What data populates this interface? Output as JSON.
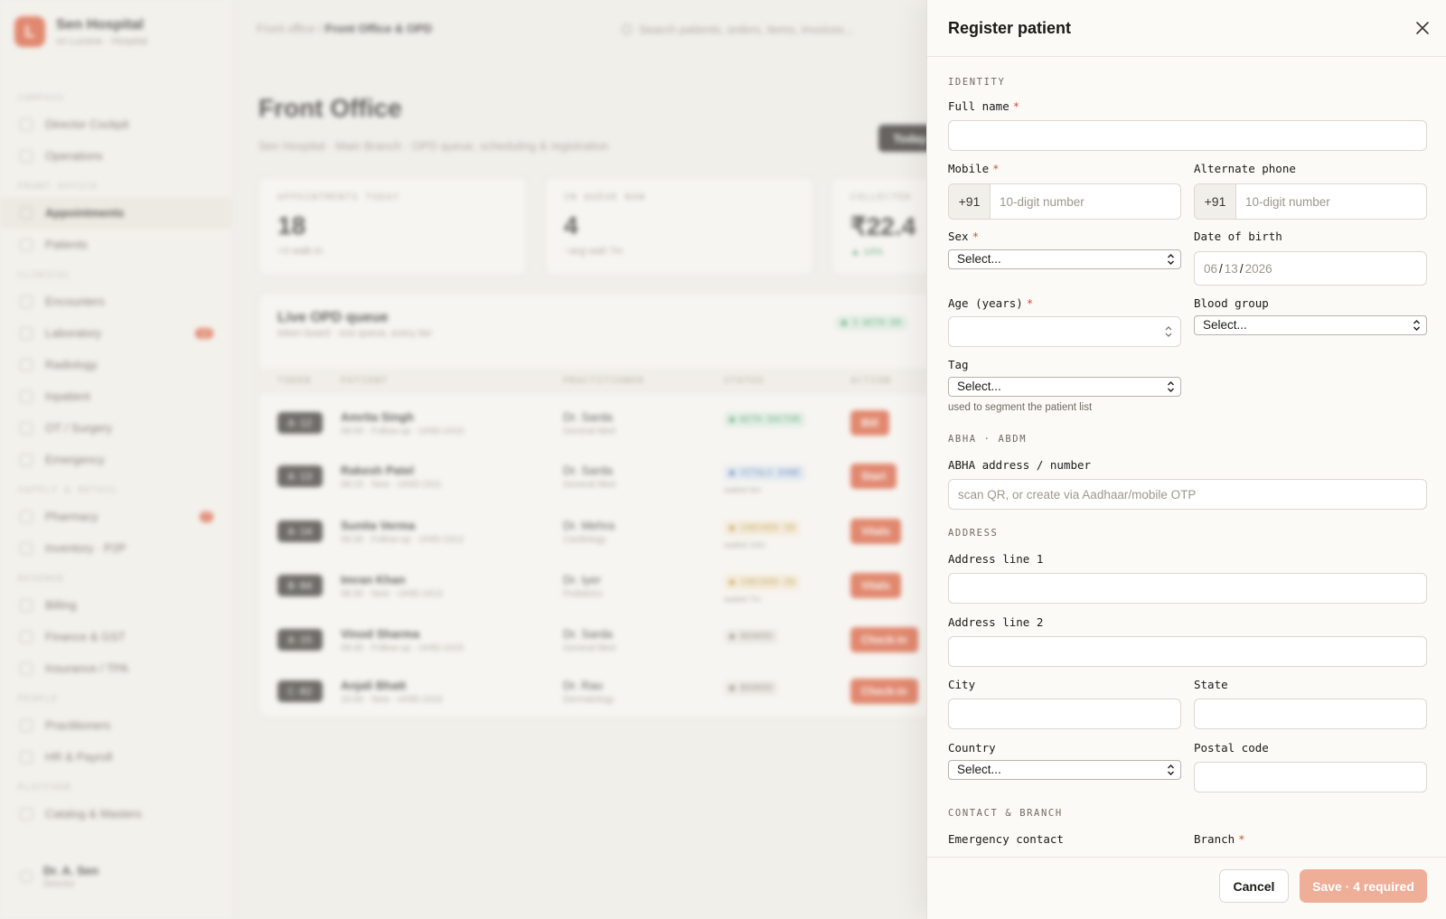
{
  "app": {
    "brand_logo": "L",
    "brand_name": "Sen Hospital",
    "brand_sub": "on Lucene · Hospital",
    "breadcrumb_parent": "Front office /",
    "breadcrumb_current": "Front Office & OPD",
    "search_placeholder": "Search patients, orders, items, invoices..."
  },
  "sidebar": {
    "sections": [
      {
        "label": "COMPASS",
        "items": [
          {
            "label": "Director Cockpit"
          },
          {
            "label": "Operations"
          }
        ]
      },
      {
        "label": "FRONT OFFICE",
        "items": [
          {
            "label": "Appointments",
            "active": true
          },
          {
            "label": "Patients"
          }
        ]
      },
      {
        "label": "CLINICAL",
        "items": [
          {
            "label": "Encounters"
          },
          {
            "label": "Laboratory",
            "badge": "12"
          },
          {
            "label": "Radiology"
          },
          {
            "label": "Inpatient"
          },
          {
            "label": "OT / Surgery"
          },
          {
            "label": "Emergency"
          }
        ]
      },
      {
        "label": "SUPPLY & RETAIL",
        "items": [
          {
            "label": "Pharmacy",
            "badge": "7"
          },
          {
            "label": "Inventory · P2P"
          }
        ]
      },
      {
        "label": "REVENUE",
        "items": [
          {
            "label": "Billing"
          },
          {
            "label": "Finance & GST"
          },
          {
            "label": "Insurance / TPA"
          }
        ]
      },
      {
        "label": "PEOPLE",
        "items": [
          {
            "label": "Practitioners"
          },
          {
            "label": "HR & Payroll"
          }
        ]
      },
      {
        "label": "PLATFORM",
        "items": [
          {
            "label": "Catalog & Masters"
          }
        ]
      }
    ],
    "user_name": "Dr. A. Sen",
    "user_role": "Director"
  },
  "main": {
    "title": "Front Office",
    "subtitle": "Sen Hospital · Main Branch · OPD queue, scheduling & registration",
    "today_button": "Today",
    "stats": [
      {
        "label": "APPOINTMENTS TODAY",
        "value": "18",
        "note": "+3 walk-in",
        "tone": "muted"
      },
      {
        "label": "IN QUEUE NOW",
        "value": "4",
        "note": "~avg wait 7m",
        "tone": "muted"
      },
      {
        "label": "COLLECTED",
        "value": "₹22.4",
        "note": "▲ 14%",
        "tone": "up"
      }
    ],
    "queue": {
      "title": "Live OPD queue",
      "subtitle": "token board · one queue, every tier",
      "pill": "● 3 WITH DR",
      "headers": {
        "token": "TOKEN",
        "patient": "PATIENT",
        "practitioner": "PRACTITIONER",
        "status": "STATUS",
        "action": "ACTION"
      },
      "rows": [
        {
          "token": "A-12",
          "patient": "Amrita Singh",
          "meta": "09:00 · Follow-up · UHID-2410",
          "doctor": "Dr. Sarda",
          "dept": "General Med",
          "status": "● WITH DOCTOR",
          "status_sub": "",
          "status_color": "#2f8f55",
          "status_bg": "#dcefe3",
          "action": "Bill"
        },
        {
          "token": "A-13",
          "patient": "Rakesh Patel",
          "meta": "09:15 · New · UHID-2411",
          "doctor": "Dr. Sarda",
          "dept": "General Med",
          "status": "● VITALS DONE",
          "status_sub": "waited 6m",
          "status_color": "#3b6fb0",
          "status_bg": "#dde7f4",
          "action": "Start"
        },
        {
          "token": "A-14",
          "patient": "Sunita Verma",
          "meta": "09:30 · Follow-up · UHID-2412",
          "doctor": "Dr. Mehra",
          "dept": "Cardiology",
          "status": "● CHECKED-IN",
          "status_sub": "waited 14m",
          "status_color": "#b7862a",
          "status_bg": "#f6ecd6",
          "action": "Vitals"
        },
        {
          "token": "B-04",
          "patient": "Imran Khan",
          "meta": "09:30 · New · UHID-2413",
          "doctor": "Dr. Iyer",
          "dept": "Pediatrics",
          "status": "● CHECKED-IN",
          "status_sub": "waited 7m",
          "status_color": "#b7862a",
          "status_bg": "#f6ecd6",
          "action": "Vitals"
        },
        {
          "token": "A-15",
          "patient": "Vinod Sharma",
          "meta": "09:45 · Follow-up · UHID-2415",
          "doctor": "Dr. Sarda",
          "dept": "General Med",
          "status": "● BOOKED",
          "status_sub": "",
          "status_color": "#6f6a61",
          "status_bg": "#eceae5",
          "action": "Check-in"
        },
        {
          "token": "C-02",
          "patient": "Anjali Bhatt",
          "meta": "10:00 · New · UHID-2416",
          "doctor": "Dr. Rao",
          "dept": "Dermatology",
          "status": "● BOOKED",
          "status_sub": "",
          "status_color": "#6f6a61",
          "status_bg": "#eceae5",
          "action": "Check-in"
        }
      ]
    }
  },
  "drawer": {
    "title": "Register patient",
    "close_icon": "close-icon",
    "accent": "#d9522f",
    "sections": {
      "identity": "IDENTITY",
      "abha": "ABHA · ABDM",
      "address": "ADDRESS",
      "contact": "CONTACT & BRANCH"
    },
    "fields": {
      "full_name": {
        "label": "Full name",
        "required": "*",
        "value": ""
      },
      "mobile": {
        "label": "Mobile",
        "required": "*",
        "prefix": "+91",
        "placeholder": "10-digit number"
      },
      "alt_phone": {
        "label": "Alternate phone",
        "prefix": "+91",
        "placeholder": "10-digit number"
      },
      "sex": {
        "label": "Sex",
        "required": "*",
        "selected": "Select..."
      },
      "dob": {
        "label": "Date of birth",
        "month": "06",
        "day": "13",
        "year": "2026"
      },
      "age": {
        "label": "Age (years)",
        "required": "*",
        "value": ""
      },
      "blood_group": {
        "label": "Blood group",
        "selected": "Select..."
      },
      "tag": {
        "label": "Tag",
        "selected": "Select...",
        "hint": "used to segment the patient list"
      },
      "abha": {
        "label": "ABHA address / number",
        "placeholder": "scan QR, or create via Aadhaar/mobile OTP"
      },
      "address1": {
        "label": "Address line 1",
        "value": ""
      },
      "address2": {
        "label": "Address line 2",
        "value": ""
      },
      "city": {
        "label": "City",
        "value": ""
      },
      "state": {
        "label": "State",
        "value": ""
      },
      "country": {
        "label": "Country",
        "selected": "Select..."
      },
      "postal": {
        "label": "Postal code",
        "value": ""
      },
      "emergency": {
        "label": "Emergency contact"
      },
      "branch": {
        "label": "Branch",
        "required": "*"
      }
    },
    "footer": {
      "cancel": "Cancel",
      "save": "Save · 4 required"
    }
  }
}
